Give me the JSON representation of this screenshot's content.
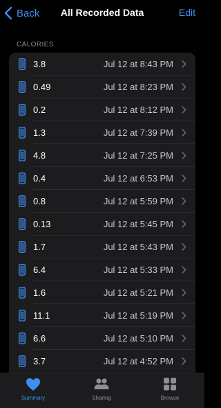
{
  "nav": {
    "back_label": "Back",
    "title": "All Recorded Data",
    "edit_label": "Edit"
  },
  "section": {
    "header": "CALORIES"
  },
  "records": [
    {
      "value": "3.8",
      "date": "Jul 12 at 8:43 PM"
    },
    {
      "value": "0.49",
      "date": "Jul 12 at 8:23 PM"
    },
    {
      "value": "0.2",
      "date": "Jul 12 at 8:12 PM"
    },
    {
      "value": "1.3",
      "date": "Jul 12 at 7:39 PM"
    },
    {
      "value": "4.8",
      "date": "Jul 12 at 7:25 PM"
    },
    {
      "value": "0.4",
      "date": "Jul 12 at 6:53 PM"
    },
    {
      "value": "0.8",
      "date": "Jul 12 at 5:59 PM"
    },
    {
      "value": "0.13",
      "date": "Jul 12 at 5:45 PM"
    },
    {
      "value": "1.7",
      "date": "Jul 12 at 5:43 PM"
    },
    {
      "value": "6.4",
      "date": "Jul 12 at 5:33 PM"
    },
    {
      "value": "1.6",
      "date": "Jul 12 at 5:21 PM"
    },
    {
      "value": "11.1",
      "date": "Jul 12 at 5:19 PM"
    },
    {
      "value": "6.6",
      "date": "Jul 12 at 5:10 PM"
    },
    {
      "value": "3.7",
      "date": "Jul 12 at 4:52 PM"
    }
  ],
  "row_icon": "iphone-icon",
  "tabs": [
    {
      "label": "Summary",
      "icon": "heart-icon",
      "active": true
    },
    {
      "label": "Sharing",
      "icon": "people-icon",
      "active": false
    },
    {
      "label": "Browse",
      "icon": "grid-icon",
      "active": false
    }
  ],
  "colors": {
    "accent": "#3e8ff5",
    "background": "#000000",
    "cell": "#1c1c1e",
    "secondary_text": "#8d8d92"
  }
}
